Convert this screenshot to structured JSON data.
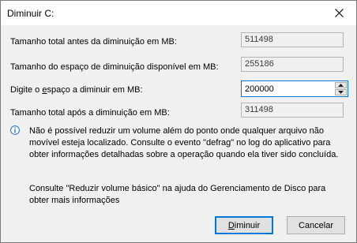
{
  "window": {
    "title": "Diminuir C:"
  },
  "rows": {
    "total_before_label": "Tamanho total antes da diminuição em MB:",
    "total_before_value": "511498",
    "available_label": "Tamanho do espaço de diminuição disponível em MB:",
    "available_value": "255186",
    "enter_label_pre": "Digite o ",
    "enter_label_accel": "e",
    "enter_label_post": "spaço a diminuir em MB:",
    "enter_value": "200000",
    "total_after_label": "Tamanho total após a diminuição em MB:",
    "total_after_value": "311498"
  },
  "info": {
    "text": "Não é possível reduzir um volume além do ponto onde qualquer arquivo não movível esteja localizado. Consulte o evento \"defrag\" no log do aplicativo para obter informações detalhadas sobre a operação quando ela tiver sido concluída.",
    "help": "Consulte \"Reduzir volume básico\" na ajuda do Gerenciamento de Disco para obter mais informações"
  },
  "buttons": {
    "shrink_accel": "D",
    "shrink_rest": "iminuir",
    "cancel": "Cancelar"
  },
  "colors": {
    "accent": "#0078d7",
    "info_icon": "#1c6fd1"
  }
}
